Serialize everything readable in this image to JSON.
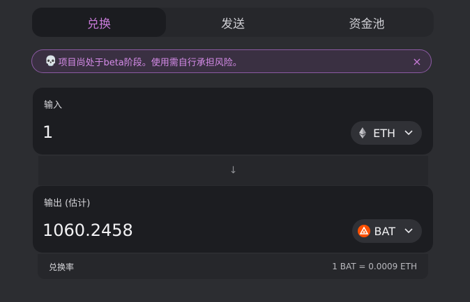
{
  "tabs": [
    {
      "label": "兑换",
      "active": true
    },
    {
      "label": "发送",
      "active": false
    },
    {
      "label": "资金池",
      "active": false
    }
  ],
  "banner": {
    "icon": "skull-icon",
    "text": "项目尚处于beta阶段。使用需自行承担风险。",
    "close_label": "×"
  },
  "input_card": {
    "label": "输入",
    "amount": "1",
    "token": "ETH",
    "token_icon": "eth-icon"
  },
  "output_card": {
    "label": "输出 (估计)",
    "amount": "1060.2458",
    "token": "BAT",
    "token_icon": "bat-icon"
  },
  "swap_arrow": "↓",
  "rate": {
    "label": "兑换率",
    "value": "1 BAT = 0.0009 ETH"
  },
  "colors": {
    "accent": "#c77ad8",
    "bat": "#ff5000",
    "background": "#2c2d31",
    "card": "#1c1d21"
  }
}
